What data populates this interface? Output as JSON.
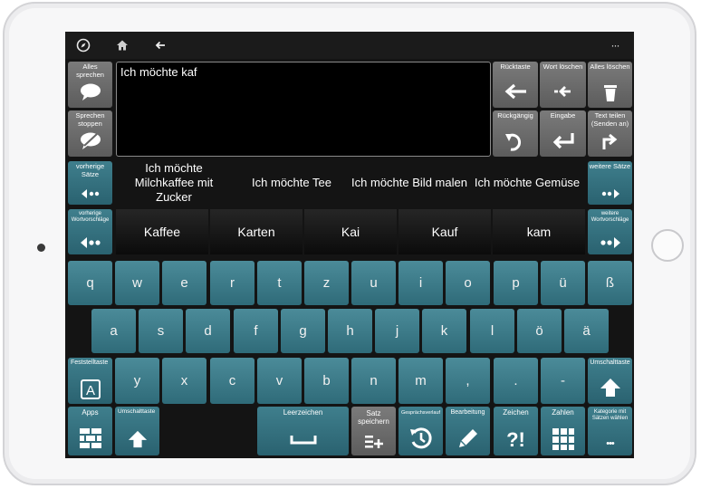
{
  "topbar": {
    "icons": [
      "compass-icon",
      "home-icon",
      "back-arrow-icon",
      "more-icon"
    ],
    "more": "···"
  },
  "left_panel": {
    "speak_all": "Alles sprechen",
    "stop_speaking": "Sprechen stoppen"
  },
  "text_input": {
    "value": "Ich möchte kaf"
  },
  "right_panel": {
    "backspace": "Rücktaste",
    "delete_word": "Wort löschen",
    "delete_all": "Alles löschen",
    "undo": "Rückgängig",
    "enter": "Eingabe",
    "share": "Text teilen (Senden an)"
  },
  "sentences": {
    "prev_label": "vorherige Sätze",
    "next_label": "weitere Sätze",
    "items": [
      "Ich möchte Milchkaffee mit Zucker",
      "Ich möchte Tee",
      "Ich möchte Bild malen",
      "Ich möchte Gemüse"
    ]
  },
  "words": {
    "prev_label": "vorherige Wortvorschläge",
    "next_label": "weitere Wortvorschläge",
    "items": [
      "Kaffee",
      "Karten",
      "Kai",
      "Kauf",
      "kam"
    ]
  },
  "keyboard": {
    "row1": [
      "q",
      "w",
      "e",
      "r",
      "t",
      "z",
      "u",
      "i",
      "o",
      "p",
      "ü",
      "ß"
    ],
    "row2": [
      "a",
      "s",
      "d",
      "f",
      "g",
      "h",
      "j",
      "k",
      "l",
      "ö",
      "ä"
    ],
    "row3": [
      "y",
      "x",
      "c",
      "v",
      "b",
      "n",
      "m",
      ",",
      ".",
      "-"
    ],
    "caps_label": "Feststelltaste",
    "caps_glyph": "A",
    "shift_label": "Umschalttaste"
  },
  "bottom": {
    "apps": "Apps",
    "shift": "Umschalttaste",
    "space": "Leerzeichen",
    "save_sentence": "Satz speichern",
    "history": "Gesprächsverlauf",
    "edit": "Bearbeitung",
    "symbols": "Zeichen",
    "symbols_glyph": "?!",
    "numbers": "Zahlen",
    "choose_category": "Kategorie mit Sätzen wählen",
    "choose_glyph": "•••"
  },
  "colors": {
    "teal": "#3a7886",
    "gray_button": "#6b6b6b",
    "screen_bg": "#141414"
  }
}
